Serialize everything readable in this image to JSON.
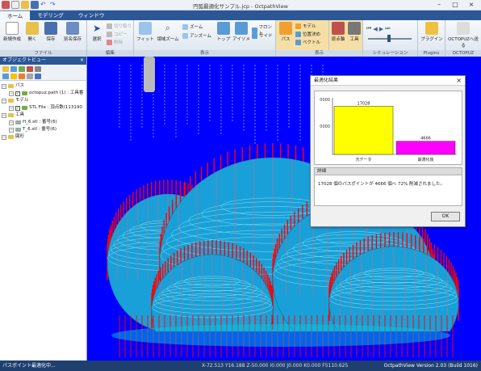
{
  "window": {
    "title": "円弧最適化サンプル.jcp - OctpathView"
  },
  "tabs": [
    "ホーム",
    "モデリング",
    "ウィンドウ"
  ],
  "ribbon": {
    "file": {
      "label": "ファイル",
      "new": "新規作成",
      "open": "開く",
      "save": "保存",
      "saveas": "別名保存"
    },
    "edit": {
      "label": "編集",
      "select": "選択",
      "delete": "削除",
      "copy": "コピー",
      "cut": "切り取り"
    },
    "view": {
      "label": "表示",
      "fit": "フィット",
      "rectzoom": "領域ズーム",
      "zoom": "ズーム",
      "unzoom": "アンズーム",
      "top": "トップ",
      "iso": "アイソメ",
      "front": "フロント",
      "side": "サイド"
    },
    "display": {
      "path": "パス",
      "model": "モデル",
      "position": "位置決め",
      "vector": "ベクトル",
      "origin": "原点軸",
      "tool": "工具"
    },
    "simulation": {
      "label": "シミュレーション"
    },
    "plugins": {
      "label": "Plugins",
      "plugin": "プラグイン"
    },
    "octopuz": {
      "label": "OCTOPUZ",
      "send": "OCTOPUZへ送る"
    }
  },
  "objectview": {
    "title": "オブジェクトビュー",
    "tree": [
      {
        "text": "パス",
        "level": 0,
        "type": "folder"
      },
      {
        "text": "octopuz.path (1) : 工具番",
        "level": 1,
        "type": "check"
      },
      {
        "text": "モデル",
        "level": 0,
        "type": "folder"
      },
      {
        "text": "STL File : 頂点数(113190",
        "level": 1,
        "type": "check"
      },
      {
        "text": "工具",
        "level": 0,
        "type": "folder"
      },
      {
        "text": "H_6.stl : 番号(6)",
        "level": 1,
        "type": "item"
      },
      {
        "text": "T_6.stl : 番号(6)",
        "level": 1,
        "type": "item"
      },
      {
        "text": "図形",
        "level": 0,
        "type": "folder"
      }
    ]
  },
  "dialog": {
    "title": "最適化結果",
    "detail_label": "詳細",
    "message": "17028 個のパスポイントが 4666 個へ 72% 削減されました。",
    "ok": "OK"
  },
  "chart_data": {
    "type": "bar",
    "categories": [
      "元データ",
      "最適化後"
    ],
    "values": [
      17028,
      4666
    ],
    "ylim": [
      0,
      20000
    ],
    "ytick_labels": [
      "0000",
      "0000"
    ],
    "colors": [
      "#ffff00",
      "#ff00ff"
    ]
  },
  "status": {
    "left": "パスポイント最適化中...",
    "middle": "X-72.513 Y16.188 Z-50.000 I0.000 J0.000 K0.000 F5110.625",
    "right": "OctpathView Version 2.03 (Build 1016)"
  },
  "colors": {
    "viewport_bg": "#0000ff",
    "path": "#ff0000",
    "surface": "#00c8e0",
    "accent": "#2b5797"
  }
}
